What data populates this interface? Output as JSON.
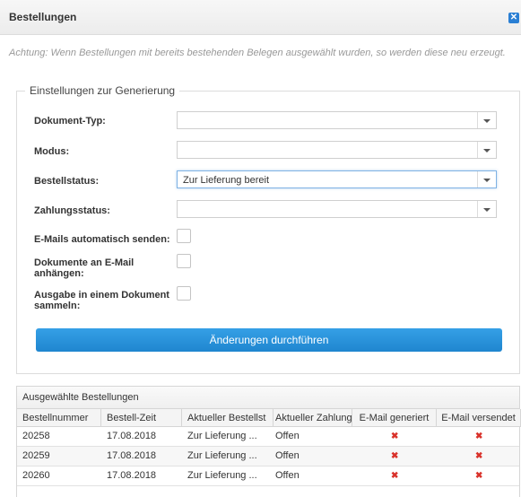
{
  "dialog": {
    "title": "Bestellungen",
    "close_icon": "close-icon"
  },
  "warning": "Achtung: Wenn Bestellungen mit bereits bestehenden Belegen ausgewählt wurden, so werden diese neu erzeugt.",
  "settings": {
    "legend": "Einstellungen zur Generierung",
    "dokument_typ": {
      "label": "Dokument-Typ:",
      "value": ""
    },
    "modus": {
      "label": "Modus:",
      "value": ""
    },
    "bestellstatus": {
      "label": "Bestellstatus:",
      "value": "Zur Lieferung bereit"
    },
    "zahlungsstatus": {
      "label": "Zahlungsstatus:",
      "value": ""
    },
    "emails_senden": {
      "label": "E-Mails automatisch senden:",
      "checked": false
    },
    "dokumente_anhaengen": {
      "label": "Dokumente an E-Mail anhängen:",
      "checked": false
    },
    "ausgabe_sammeln": {
      "label": "Ausgabe in einem Dokument sammeln:",
      "checked": false
    },
    "submit_label": "Änderungen durchführen"
  },
  "orders": {
    "title": "Ausgewählte Bestellungen",
    "columns": [
      "Bestellnummer",
      "Bestell-Zeit",
      "Aktueller Bestellst",
      "Aktueller Zahlung",
      "E-Mail generiert",
      "E-Mail versendet"
    ],
    "rows": [
      {
        "nr": "20258",
        "zeit": "17.08.2018",
        "bestellstatus": "Zur Lieferung ...",
        "zahlung": "Offen",
        "generiert": "✖",
        "versendet": "✖"
      },
      {
        "nr": "20259",
        "zeit": "17.08.2018",
        "bestellstatus": "Zur Lieferung ...",
        "zahlung": "Offen",
        "generiert": "✖",
        "versendet": "✖"
      },
      {
        "nr": "20260",
        "zeit": "17.08.2018",
        "bestellstatus": "Zur Lieferung ...",
        "zahlung": "Offen",
        "generiert": "✖",
        "versendet": "✖"
      }
    ]
  }
}
